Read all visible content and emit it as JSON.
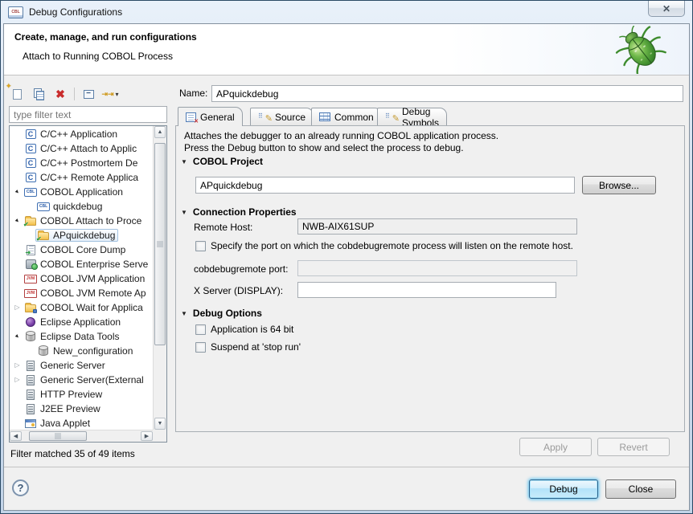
{
  "window": {
    "title": "Debug Configurations",
    "icon_glyph": "CBL"
  },
  "banner": {
    "title": "Create, manage, and run configurations",
    "subtitle": "Attach to Running COBOL Process"
  },
  "icons": {
    "close": "✕",
    "new_star": "✦",
    "delete": "✖",
    "collapse_minus": "−",
    "filter_arrows": "⇥⇥",
    "dropdown_caret": "▾",
    "section_collapse": "▼",
    "expander_expanded": "▸",
    "expander_collapsed": "▷",
    "scroll_up": "▲",
    "scroll_down": "▼",
    "scroll_left": "◀",
    "scroll_right": "▶",
    "check_overlay": "✔",
    "help": "?",
    "c_glyph": "C",
    "cbl_glyph": "CBL",
    "jvm_glyph": "JVM"
  },
  "filter": {
    "placeholder": "type filter text",
    "status": "Filter matched 35 of 49 items"
  },
  "tree": {
    "items": [
      {
        "label": "C/C++ Application",
        "icon": "c-icon"
      },
      {
        "label": "C/C++ Attach to Applic",
        "icon": "c-icon"
      },
      {
        "label": "C/C++ Postmortem De",
        "icon": "c-icon"
      },
      {
        "label": "C/C++ Remote Applica",
        "icon": "c-icon"
      },
      {
        "label": "COBOL Application",
        "icon": "cobol-icon",
        "expanded": true
      },
      {
        "label": "quickdebug",
        "icon": "cobol-icon",
        "child": true
      },
      {
        "label": "COBOL Attach to Proce",
        "icon": "folder-check-icon",
        "expanded": true
      },
      {
        "label": "APquickdebug",
        "icon": "folder-check-icon",
        "child": true,
        "selected": true
      },
      {
        "label": "COBOL Core Dump",
        "icon": "core-dump-icon"
      },
      {
        "label": "COBOL Enterprise Serve",
        "icon": "enterprise-server-icon"
      },
      {
        "label": "COBOL JVM Application",
        "icon": "jvm-icon"
      },
      {
        "label": "COBOL JVM Remote Ap",
        "icon": "jvm-icon"
      },
      {
        "label": "COBOL Wait for Applica",
        "icon": "folder-wait-icon",
        "collapsed": true
      },
      {
        "label": "Eclipse Application",
        "icon": "eclipse-sphere-icon"
      },
      {
        "label": "Eclipse Data Tools",
        "icon": "database-icon",
        "expanded": true
      },
      {
        "label": "New_configuration",
        "icon": "database-icon",
        "child": true
      },
      {
        "label": "Generic Server",
        "icon": "server-icon",
        "collapsed": true
      },
      {
        "label": "Generic Server(External",
        "icon": "server-icon",
        "collapsed": true
      },
      {
        "label": "HTTP Preview",
        "icon": "server-icon"
      },
      {
        "label": "J2EE Preview",
        "icon": "server-icon"
      },
      {
        "label": "Java Applet",
        "icon": "applet-icon"
      }
    ]
  },
  "name_row": {
    "label": "Name:",
    "value": "APquickdebug"
  },
  "tabs": [
    {
      "label": "General",
      "active": true
    },
    {
      "label": "Source"
    },
    {
      "label": "Common"
    },
    {
      "label": "Debug Symbols"
    }
  ],
  "general_tab": {
    "description_line1": "Attaches the debugger to an already running COBOL application process.",
    "description_line2": "Press the Debug button to show and select the process to debug.",
    "cobol_project": {
      "title": "COBOL Project",
      "project_value": "APquickdebug",
      "browse_label": "Browse..."
    },
    "connection": {
      "title": "Connection Properties",
      "remote_host_label": "Remote Host:",
      "remote_host_value": "NWB-AIX61SUP",
      "port_checkbox_label": "Specify the port on which the cobdebugremote process will listen on the remote host.",
      "port_label": "cobdebugremote port:",
      "port_value": "",
      "xserver_label": "X Server (DISPLAY):",
      "xserver_value": ""
    },
    "debug_options": {
      "title": "Debug Options",
      "checkbox_64bit": "Application is 64 bit",
      "checkbox_suspend": "Suspend at 'stop run'"
    },
    "apply_label": "Apply",
    "revert_label": "Revert"
  },
  "footer": {
    "debug_label": "Debug",
    "close_label": "Close"
  }
}
